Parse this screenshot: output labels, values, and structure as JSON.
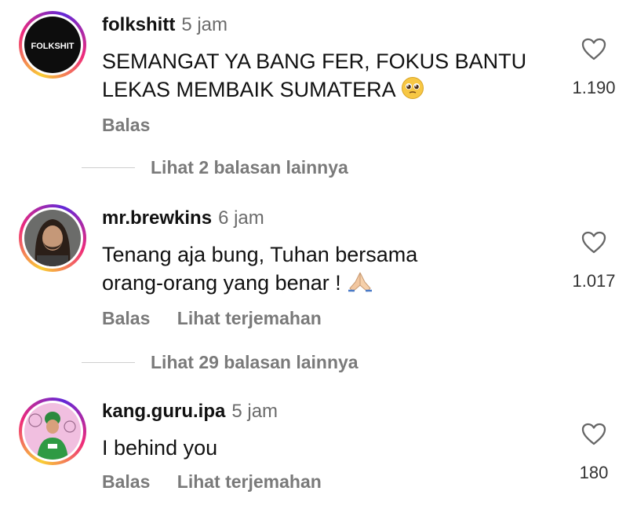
{
  "comments": [
    {
      "username": "folkshitt",
      "time": "5 jam",
      "avatar_text": "FOLKSHIT",
      "text": "SEMANGAT YA BANG FER, FOKUS BANTU LEKAS MEMBAIK SUMATERA",
      "emoji": "pleading-face-emoji",
      "reply_label": "Balas",
      "likes": "1.190"
    },
    {
      "username": "mr.brewkins",
      "time": "6 jam",
      "text": "Tenang aja bung, Tuhan bersama orang-orang yang benar !",
      "emoji": "folded-hands-emoji",
      "reply_label": "Balas",
      "translate_label": "Lihat terjemahan",
      "likes": "1.017"
    },
    {
      "username": "kang.guru.ipa",
      "time": "5 jam",
      "text": "I behind you",
      "reply_label": "Balas",
      "translate_label": "Lihat terjemahan",
      "likes": "180"
    }
  ],
  "replies": [
    {
      "label": "Lihat 2 balasan lainnya"
    },
    {
      "label": "Lihat 29 balasan lainnya"
    }
  ],
  "colors": {
    "ring_gradient": [
      "#f9ce34",
      "#ee2a7b",
      "#6228d7"
    ],
    "muted_text": "#7a7a7a",
    "username_text": "#111111"
  }
}
